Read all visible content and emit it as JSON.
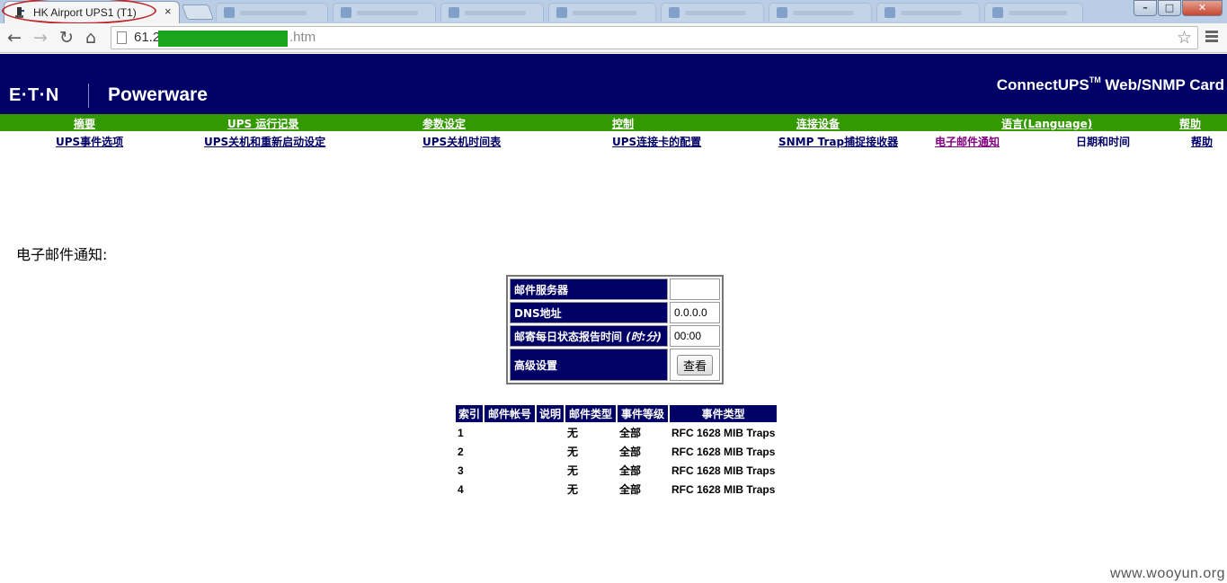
{
  "browser": {
    "active_tab_title": "HK Airport UPS1 (T1)",
    "tab_close": "×",
    "url_prefix": "61.2",
    "url_suffix": ".htm",
    "nav_back": "←",
    "nav_forward": "→",
    "nav_reload": "↻",
    "nav_home": "⌂",
    "star": "☆",
    "win_minimize": "–",
    "win_maximize": "□",
    "win_close": "✕",
    "redaction_color": "#1aa51a",
    "annotation_color": "#c0282d"
  },
  "header": {
    "brand": "E·T·N",
    "brand_prefix": "E",
    "partner": "Powerware",
    "product_name": "ConnectUPS",
    "product_tm": "TM",
    "product_suffix": " Web/SNMP Card",
    "band_color": "#000066"
  },
  "nav": {
    "bar_color": "#339900",
    "items": [
      {
        "label": "摘要"
      },
      {
        "label": "UPS 运行记录"
      },
      {
        "label": "参数设定"
      },
      {
        "label": "控制"
      },
      {
        "label": "连接设备"
      },
      {
        "label": "语言(Language)"
      },
      {
        "label": "帮助"
      }
    ]
  },
  "subnav": {
    "items": [
      {
        "label": "UPS事件选项"
      },
      {
        "label": "UPS关机和重新启动设定"
      },
      {
        "label": "UPS关机时间表"
      },
      {
        "label": "UPS连接卡的配置"
      },
      {
        "label": "SNMP Trap捕捉接收器"
      },
      {
        "label": "电子邮件通知"
      },
      {
        "label": "日期和时间"
      },
      {
        "label": "帮助"
      }
    ]
  },
  "main": {
    "section_title": "电子邮件通知:",
    "settings": {
      "mail_server_label": "邮件服务器",
      "mail_server_value": "",
      "dns_label": "DNS地址",
      "dns_value": "0.0.0.0",
      "daily_report_label": "邮寄每日状态报告时间",
      "daily_report_unit": "(时:分)",
      "daily_report_value": "00:00",
      "advanced_label": "高级设置",
      "view_button": "查看"
    },
    "email_table": {
      "headers": [
        "索引",
        "邮件帐号",
        "说明",
        "邮件类型",
        "事件等级",
        "事件类型"
      ],
      "rows": [
        {
          "index": "1",
          "account": "",
          "description": "",
          "mail_type": "无",
          "level": "全部",
          "event_type": "RFC 1628 MIB Traps"
        },
        {
          "index": "2",
          "account": "",
          "description": "",
          "mail_type": "无",
          "level": "全部",
          "event_type": "RFC 1628 MIB Traps"
        },
        {
          "index": "3",
          "account": "",
          "description": "",
          "mail_type": "无",
          "level": "全部",
          "event_type": "RFC 1628 MIB Traps"
        },
        {
          "index": "4",
          "account": "",
          "description": "",
          "mail_type": "无",
          "level": "全部",
          "event_type": "RFC 1628 MIB Traps"
        }
      ]
    }
  },
  "watermark": "www.wooyun.org"
}
